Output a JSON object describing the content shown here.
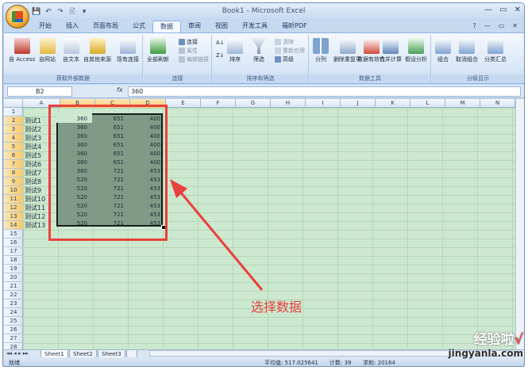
{
  "window": {
    "title": "Book1 - Microsoft Excel",
    "controls": [
      "—",
      "▭",
      "✕"
    ]
  },
  "qat": [
    "💾",
    "↶",
    "↷",
    "🖹",
    "▾"
  ],
  "tabs": [
    "开始",
    "插入",
    "页面布局",
    "公式",
    "数据",
    "审阅",
    "视图",
    "开发工具",
    "福昕PDF"
  ],
  "active_tab": "数据",
  "ribbon": {
    "groups": [
      {
        "label": "获取外部数据",
        "buttons": [
          "自 Access",
          "自网站",
          "自文本",
          "自其他来源",
          "现有连接"
        ]
      },
      {
        "label": "连接",
        "big": "全部刷新",
        "small": [
          "连接",
          "属性",
          "编辑链接"
        ]
      },
      {
        "label": "排序和筛选",
        "big": [
          "排序",
          "筛选"
        ],
        "small": [
          "清除",
          "重新应用",
          "高级"
        ]
      },
      {
        "label": "数据工具",
        "buttons": [
          "分列",
          "删除重复项",
          "数据有效性",
          "合并计算",
          "假设分析"
        ]
      },
      {
        "label": "分级显示",
        "buttons": [
          "组合",
          "取消组合",
          "分类汇总"
        ]
      }
    ],
    "help_icons": [
      "?",
      "—",
      "▭",
      "✕"
    ]
  },
  "formula_bar": {
    "name_box": "B2",
    "fx": "fx",
    "value": "360"
  },
  "columns": [
    "A",
    "B",
    "C",
    "D",
    "E",
    "F",
    "G",
    "H",
    "I",
    "J",
    "K",
    "L",
    "M",
    "N"
  ],
  "rows": [
    "1",
    "2",
    "3",
    "4",
    "5",
    "6",
    "7",
    "8",
    "9",
    "10",
    "11",
    "12",
    "13",
    "14",
    "15",
    "16",
    "17",
    "18",
    "19",
    "20",
    "21",
    "22",
    "23",
    "24",
    "25",
    "26",
    "27",
    "28"
  ],
  "data_rows": [
    {
      "label": "测试1",
      "b": "360",
      "c": "651",
      "d": "400"
    },
    {
      "label": "测试2",
      "b": "360",
      "c": "651",
      "d": "400"
    },
    {
      "label": "测试3",
      "b": "360",
      "c": "651",
      "d": "400"
    },
    {
      "label": "测试4",
      "b": "360",
      "c": "651",
      "d": "400"
    },
    {
      "label": "测试5",
      "b": "360",
      "c": "651",
      "d": "400"
    },
    {
      "label": "测试6",
      "b": "360",
      "c": "651",
      "d": "400"
    },
    {
      "label": "测试7",
      "b": "360",
      "c": "721",
      "d": "453"
    },
    {
      "label": "测试8",
      "b": "520",
      "c": "721",
      "d": "453"
    },
    {
      "label": "测试9",
      "b": "520",
      "c": "721",
      "d": "453"
    },
    {
      "label": "测试10",
      "b": "520",
      "c": "721",
      "d": "453"
    },
    {
      "label": "测试11",
      "b": "520",
      "c": "721",
      "d": "453"
    },
    {
      "label": "测试12",
      "b": "520",
      "c": "721",
      "d": "453"
    },
    {
      "label": "测试13",
      "b": "520",
      "c": "721",
      "d": "453"
    }
  ],
  "annotation": "选择数据",
  "sheets": [
    "Sheet1",
    "Sheet2",
    "Sheet3"
  ],
  "status": {
    "mode": "就绪",
    "average": "平均值: 517.025641",
    "count": "计数: 39",
    "sum": "求和: 20164"
  },
  "watermark": {
    "line1": "经验啦",
    "check": "√",
    "line2": "jingyanla.com"
  },
  "colors": {
    "accent": "#e8413d",
    "grid": "#cce8cf"
  }
}
